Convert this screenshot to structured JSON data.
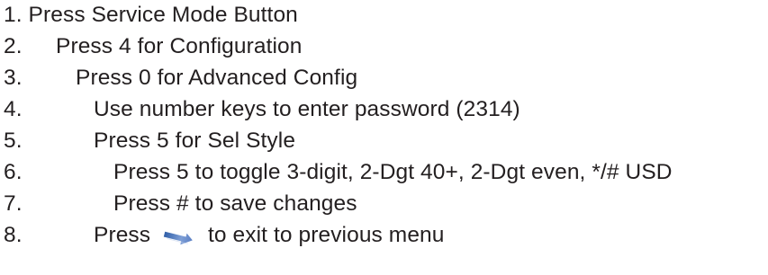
{
  "steps": [
    {
      "number": "",
      "text": "1. Press Service Mode Button"
    },
    {
      "number": "2.",
      "text": "Press 4 for Configuration"
    },
    {
      "number": "3.",
      "text": "Press 0 for Advanced Config"
    },
    {
      "number": "4.",
      "text": "Use number keys to enter password (2314)"
    },
    {
      "number": "5.",
      "text": "Press 5 for Sel Style"
    },
    {
      "number": "6.",
      "text": "Press 5 to toggle 3-digit, 2-Dgt 40+, 2-Dgt even, */# USD"
    },
    {
      "number": "7.",
      "text": "Press # to save changes"
    },
    {
      "number": "8.",
      "text_before": "Press",
      "text_after": "to exit to previous menu",
      "icon": "back-arrow-icon"
    }
  ],
  "colors": {
    "text": "#231f20",
    "icon": "#5b7fc4"
  }
}
